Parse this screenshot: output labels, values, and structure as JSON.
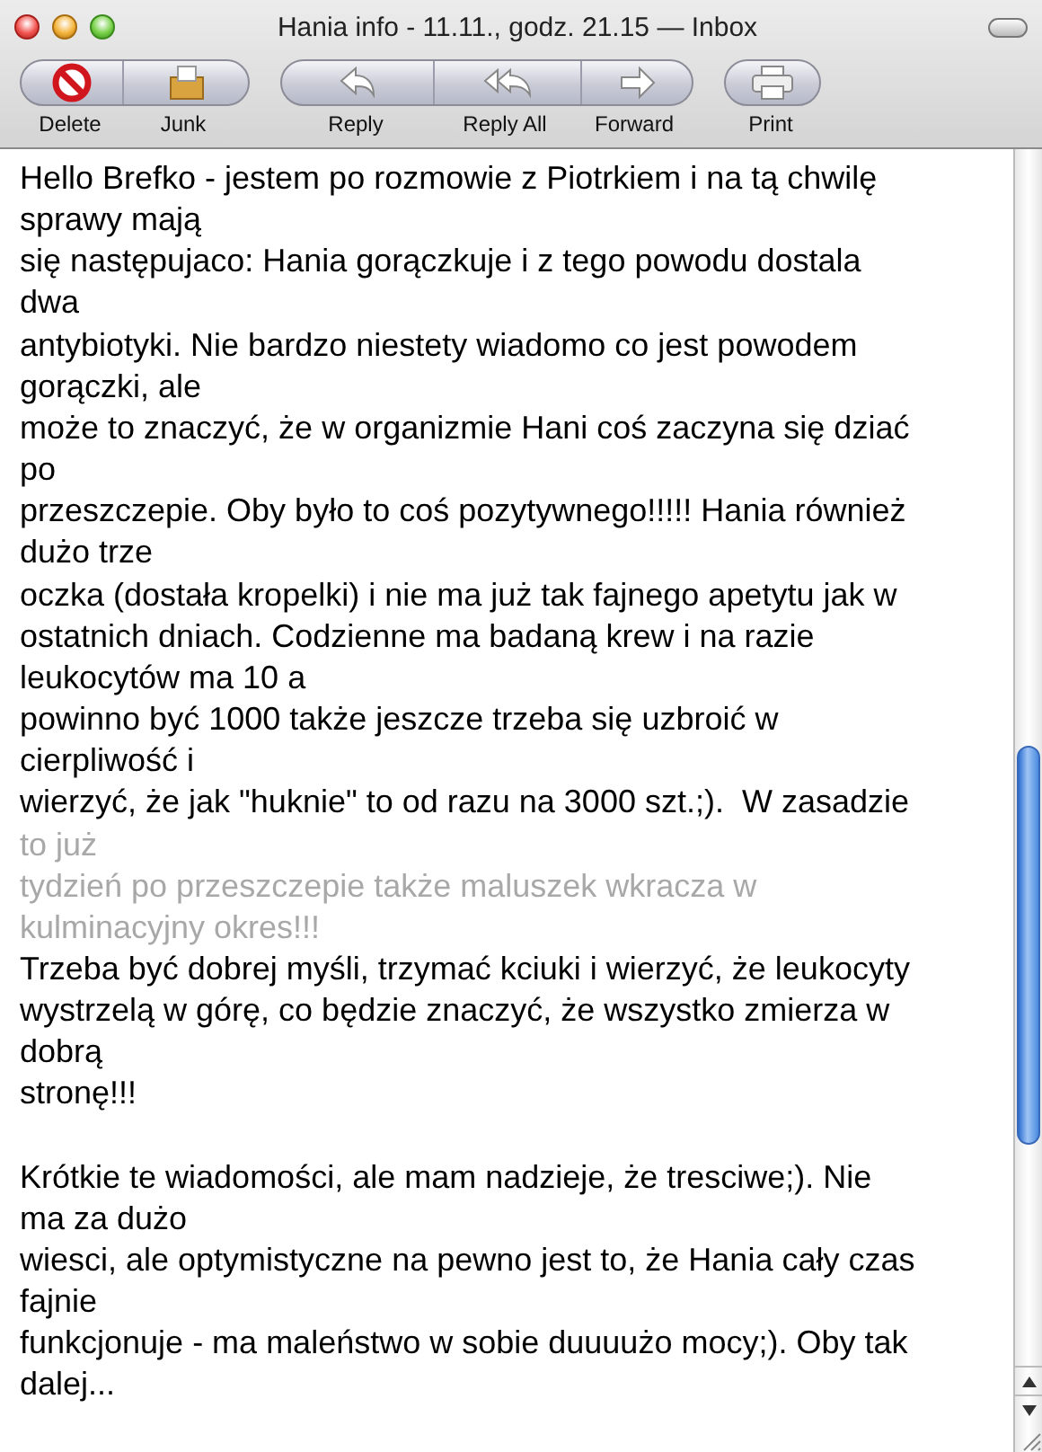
{
  "window": {
    "title": "Hania info - 11.11., godz. 21.15 — Inbox"
  },
  "toolbar": {
    "groups": [
      {
        "buttons": [
          {
            "kind": "delete",
            "label": "Delete"
          },
          {
            "kind": "junk",
            "label": "Junk"
          }
        ]
      },
      {
        "buttons": [
          {
            "kind": "reply",
            "label": "Reply"
          },
          {
            "kind": "reply_all",
            "label": "Reply All"
          },
          {
            "kind": "forward",
            "label": "Forward"
          }
        ]
      },
      {
        "buttons": [
          {
            "kind": "print",
            "label": "Print"
          }
        ]
      }
    ]
  },
  "message": {
    "paragraphs": [
      {
        "lines": [
          {
            "text": "Hello Brefko - jestem po rozmowie z Piotrkiem i na tą chwilę",
            "faded": false
          },
          {
            "text": "sprawy mają",
            "faded": false
          },
          {
            "text": "się następujaco: Hania gorączkuje i z tego powodu dostala",
            "faded": false
          },
          {
            "text": "dwa",
            "faded": false
          },
          {
            "text": "antybiotyki. Nie bardzo niestety wiadomo co jest powodem",
            "faded": false
          },
          {
            "text": "gorączki, ale",
            "faded": false
          },
          {
            "text": "może to znaczyć, że w organizmie Hani coś zaczyna się dziać",
            "faded": false
          },
          {
            "text": "po",
            "faded": false
          },
          {
            "text": "przeszczepie. Oby było to coś pozytywnego!!!!! Hania również",
            "faded": false
          },
          {
            "text": "dużo trze",
            "faded": false
          },
          {
            "text": "oczka (dostała kropelki) i nie ma już tak fajnego apetytu jak w",
            "faded": false
          },
          {
            "text": "ostatnich dniach. Codzienne ma badaną krew i na razie",
            "faded": false
          },
          {
            "text": "leukocytów ma 10 a",
            "faded": false
          },
          {
            "text": "powinno być 1000 także jeszcze trzeba się uzbroić w",
            "faded": false
          },
          {
            "text": "cierpliwość i",
            "faded": false
          },
          {
            "text": "wierzyć, że jak \"huknie\" to od razu na 3000 szt.;).  W zasadzie",
            "faded": false
          },
          {
            "text": "to już",
            "faded": true
          },
          {
            "text": "tydzień po przeszczepie także maluszek wkracza w",
            "faded": true
          },
          {
            "text": "kulminacyjny okres!!!",
            "faded": true
          },
          {
            "text": "Trzeba być dobrej myśli, trzymać kciuki i wierzyć, że leukocyty",
            "faded": false
          },
          {
            "text": "wystrzelą w górę, co będzie znaczyć, że wszystko zmierza w",
            "faded": false
          },
          {
            "text": "dobrą",
            "faded": false
          },
          {
            "text": "stronę!!!",
            "faded": false
          }
        ]
      },
      {
        "lines": [
          {
            "text": "Krótkie te wiadomości, ale mam nadzieje, że tresciwe;). Nie",
            "faded": false
          },
          {
            "text": "ma za dużo",
            "faded": false
          },
          {
            "text": "wiesci, ale optymistyczne na pewno jest to, że Hania cały czas",
            "faded": false
          },
          {
            "text": "fajnie",
            "faded": false
          },
          {
            "text": "funkcjonuje - ma maleństwo w sobie duuuużo mocy;). Oby tak",
            "faded": false
          },
          {
            "text": "dalej...",
            "faded": false
          }
        ]
      }
    ]
  }
}
